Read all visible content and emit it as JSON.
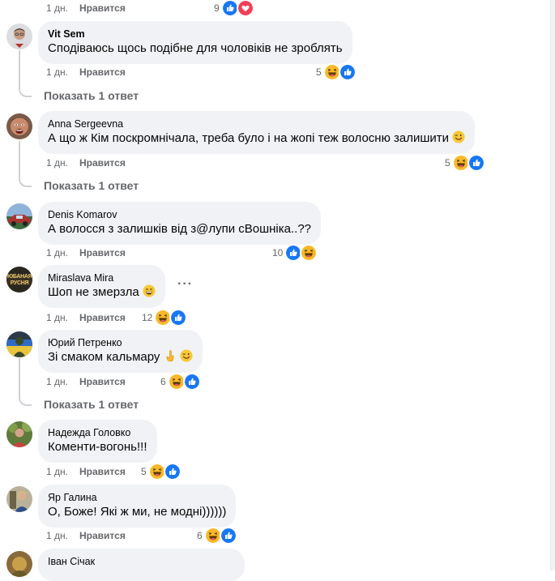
{
  "ui": {
    "like_label": "Нравится",
    "reply_label": "Показать 1 ответ"
  },
  "top_partial": {
    "time": "1 дн.",
    "count": "9",
    "reactions": [
      "like-icon",
      "love-icon"
    ]
  },
  "comments": [
    {
      "author": "Vit Sem",
      "text": "Сподіваюсь щось подібне для чоловіків не зроблять",
      "time": "1 дн.",
      "count": "5",
      "reactions": [
        "haha-icon",
        "like-icon"
      ]
    },
    {
      "author": "Anna Sergeevna",
      "text": "А що ж Кім поскромнічала, треба було і на жопі теж волосню залишити",
      "time": "1 дн.",
      "count": "5",
      "reactions": [
        "haha-icon",
        "like-icon"
      ]
    },
    {
      "author": "Denis Komarov",
      "text": "А волосся з залишків від з@лупи сВошніка..??",
      "time": "1 дн.",
      "count": "10",
      "reactions": [
        "like-icon",
        "haha-icon"
      ]
    },
    {
      "author": "Miraslava Mira",
      "text": "Шоп не змерзла",
      "time": "1 дн.",
      "count": "12",
      "reactions": [
        "haha-icon",
        "like-icon"
      ]
    },
    {
      "author": "Юрий Петренко",
      "text": "Зі смаком кальмару",
      "time": "1 дн.",
      "count": "6",
      "reactions": [
        "haha-icon",
        "like-icon"
      ]
    },
    {
      "author": "Надежда Головко",
      "text": "Коменти-вогонь!!!",
      "time": "1 дн.",
      "count": "5",
      "reactions": [
        "haha-icon",
        "like-icon"
      ]
    },
    {
      "author": "Яр Галина",
      "text": "О, Боже! Які ж ми, не модні))))))",
      "time": "1 дн.",
      "count": "6",
      "reactions": [
        "haha-icon",
        "like-icon"
      ]
    },
    {
      "author": "Іван Січак",
      "text": "",
      "time": "",
      "count": "",
      "reactions": []
    }
  ],
  "avatar_text": {
    "miraslava": "ЮБАНАЯ РУСНЯ"
  },
  "colors": {
    "bubble": "#f0f2f5",
    "like_blue": "#1877f2",
    "love_red": "#f33e58",
    "haha_yellow": "#f7b928",
    "meta_gray": "#65676b"
  }
}
